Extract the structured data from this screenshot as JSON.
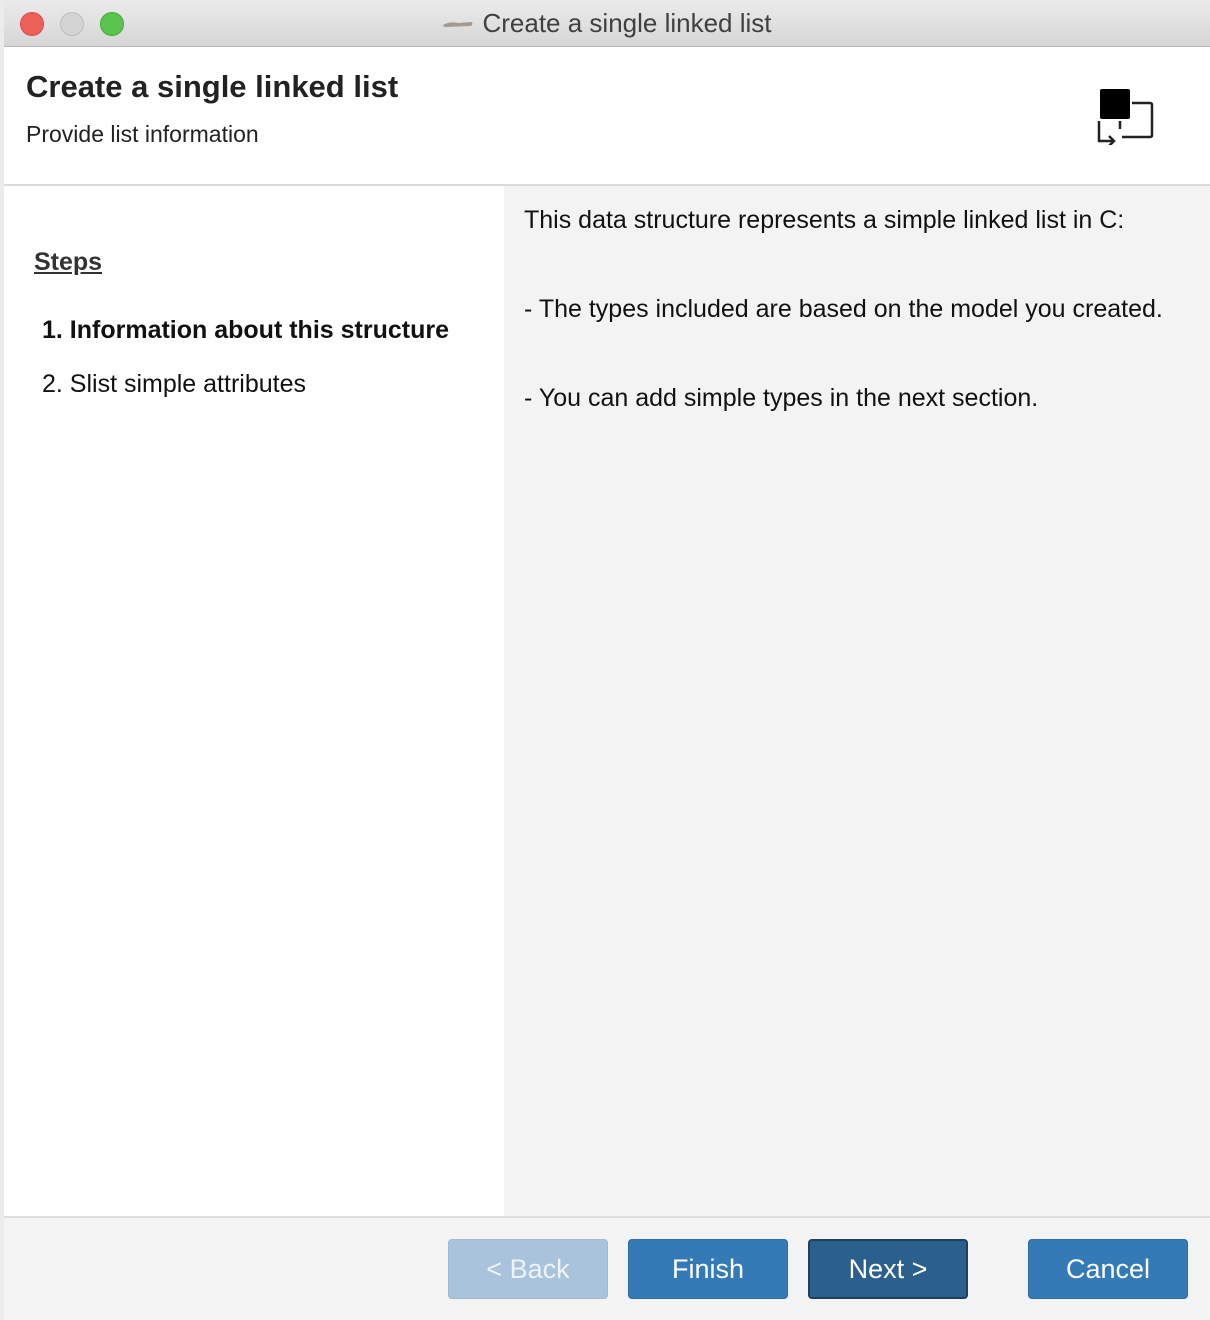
{
  "window": {
    "title": "Create a single linked list"
  },
  "header": {
    "title": "Create a single linked list",
    "subtitle": "Provide list information",
    "icon": "wizard-swap-icon"
  },
  "steps": {
    "title": "Steps",
    "items": [
      {
        "label": "1. Information about this structure",
        "active": true
      },
      {
        "label": "2. Slist simple attributes",
        "active": false
      }
    ]
  },
  "description": {
    "line1": "This data structure represents a simple linked list in C:",
    "line2": "- The types included are based on the model you created.",
    "line3": "- You can add simple types in the next section."
  },
  "footer": {
    "back_label": "< Back",
    "finish_label": "Finish",
    "next_label": "Next >",
    "cancel_label": "Cancel",
    "back_enabled": false
  },
  "colors": {
    "primary_button": "#337ab7",
    "default_button": "#2b5f8e",
    "disabled_button": "#a9c3dc",
    "close": "#ee5f57",
    "maximize": "#5bc44e"
  }
}
